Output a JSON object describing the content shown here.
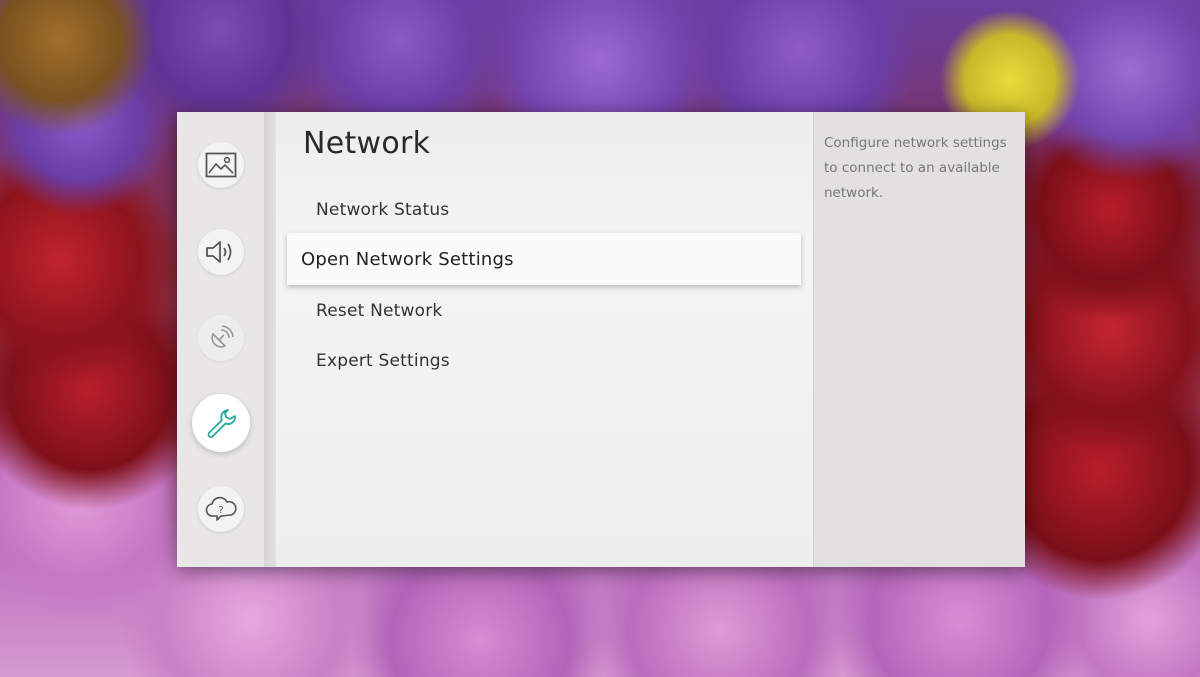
{
  "settings": {
    "title": "Network",
    "menu": [
      {
        "label": "Network Status",
        "selected": false
      },
      {
        "label": "Open Network Settings",
        "selected": true
      },
      {
        "label": "Reset Network",
        "selected": false
      },
      {
        "label": "Expert Settings",
        "selected": false
      }
    ],
    "description": "Configure network settings to connect to an available network."
  },
  "sidebar": {
    "items": [
      {
        "icon": "picture-icon",
        "state": "normal"
      },
      {
        "icon": "sound-icon",
        "state": "normal"
      },
      {
        "icon": "broadcasting-icon",
        "state": "dimmed"
      },
      {
        "icon": "wrench-icon",
        "state": "active"
      },
      {
        "icon": "support-icon",
        "state": "normal"
      }
    ]
  },
  "colors": {
    "accent": "#2aa8a0",
    "icon": "#555555",
    "selected_background": "#fbfbfb"
  }
}
